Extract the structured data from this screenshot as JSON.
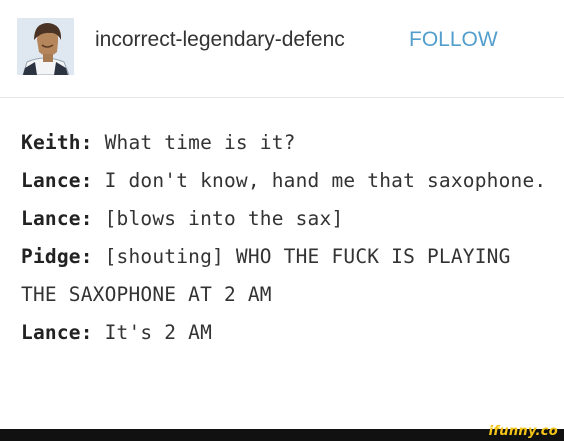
{
  "post": {
    "blog_name": "incorrect-legendary-defenc",
    "follow_label": "FOLLOW",
    "lines": [
      {
        "speaker": "Keith:",
        "text": " What time is it?"
      },
      {
        "speaker": "Lance:",
        "text": " I don't know, hand me that saxophone."
      },
      {
        "speaker": "Lance:",
        "text": " [blows into the sax]"
      },
      {
        "speaker": "Pidge:",
        "text": " [shouting] WHO THE FUCK IS PLAYING THE SAXOPHONE AT 2 AM"
      },
      {
        "speaker": "Lance:",
        "text": " It's 2 AM"
      }
    ]
  },
  "watermark": "ifunny.co",
  "colors": {
    "follow": "#529ecc",
    "watermark": "#f5c518",
    "footer": "#111111"
  }
}
